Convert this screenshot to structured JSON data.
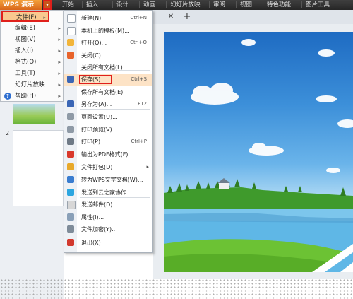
{
  "app": {
    "name": "WPS 演示",
    "dropdown_glyph": "▾"
  },
  "ribbon": {
    "tabs": [
      "开始",
      "插入",
      "设计",
      "动画",
      "幻灯片放映",
      "审阅",
      "视图",
      "特色功能",
      "图片工具"
    ]
  },
  "main_menu": {
    "items": [
      {
        "label": "文件(F)",
        "arrow": "▸",
        "icon": ""
      },
      {
        "label": "编辑(E)",
        "arrow": "▸",
        "icon": ""
      },
      {
        "label": "视图(V)",
        "arrow": "▸",
        "icon": ""
      },
      {
        "label": "插入(I)",
        "arrow": "▸",
        "icon": ""
      },
      {
        "label": "格式(O)",
        "arrow": "▸",
        "icon": ""
      },
      {
        "label": "工具(T)",
        "arrow": "▸",
        "icon": ""
      },
      {
        "label": "幻灯片放映",
        "arrow": "▸",
        "icon": ""
      },
      {
        "label": "帮助(H)",
        "arrow": "▸",
        "icon": "help-icon"
      }
    ]
  },
  "file_menu": {
    "items": [
      {
        "label": "新建(N)",
        "shortcut": "Ctrl+N",
        "icon": "new-document-icon",
        "color": "#ffffff"
      },
      {
        "label": "本机上的模板(M)...",
        "shortcut": "",
        "icon": "template-icon",
        "color": "#ffffff"
      },
      {
        "label": "打开(O)...",
        "shortcut": "Ctrl+O",
        "icon": "open-folder-icon",
        "color": "#f2b53a"
      },
      {
        "label": "关闭(C)",
        "shortcut": "",
        "icon": "close-document-icon",
        "color": "#e8632b"
      },
      {
        "label": "关闭所有文档(L)",
        "shortcut": "",
        "icon": "",
        "color": ""
      },
      {
        "label": "保存(S)",
        "shortcut": "Ctrl+S",
        "icon": "save-icon",
        "color": "#3b66b5"
      },
      {
        "label": "保存所有文档(E)",
        "shortcut": "",
        "icon": "",
        "color": ""
      },
      {
        "label": "另存为(A)...",
        "shortcut": "F12",
        "icon": "save-as-icon",
        "color": "#3b66b5"
      },
      {
        "label": "页面设置(U)...",
        "shortcut": "",
        "icon": "page-setup-icon",
        "color": "#8f9aa6"
      },
      {
        "label": "打印预览(V)",
        "shortcut": "",
        "icon": "print-preview-icon",
        "color": "#8f9aa6"
      },
      {
        "label": "打印(P)...",
        "shortcut": "Ctrl+P",
        "icon": "print-icon",
        "color": "#6f7a86"
      },
      {
        "label": "输出为PDF格式(F)...",
        "shortcut": "",
        "icon": "pdf-icon",
        "color": "#d9382b"
      },
      {
        "label": "文件打包(D)",
        "shortcut": "",
        "icon": "package-icon",
        "color": "#e8a92b",
        "arrow": "▸"
      },
      {
        "label": "转为WPS文字文档(W)...",
        "shortcut": "",
        "icon": "convert-document-icon",
        "color": "#3a7dd0"
      },
      {
        "label": "发送到云之家协作...",
        "shortcut": "",
        "icon": "cloud-share-icon",
        "color": "#2ca6e0"
      },
      {
        "label": "发送邮件(D)...",
        "shortcut": "",
        "icon": "send-mail-icon",
        "color": "#d7d7d7"
      },
      {
        "label": "属性(I)...",
        "shortcut": "",
        "icon": "properties-icon",
        "color": "#8aa0b8"
      },
      {
        "label": "文件加密(Y)...",
        "shortcut": "",
        "icon": "encrypt-icon",
        "color": "#7f8c99"
      },
      {
        "label": "退出(X)",
        "shortcut": "",
        "icon": "exit-icon",
        "color": "#d23a2e"
      }
    ]
  },
  "document_tabs": {
    "close_glyph": "✕",
    "add_glyph": "+"
  },
  "slides_panel": {
    "slide_number": "2"
  },
  "colors": {
    "accent_orange": "#e8772a",
    "highlight_red": "#e0201b",
    "menu_hover": "#fde3c6"
  }
}
